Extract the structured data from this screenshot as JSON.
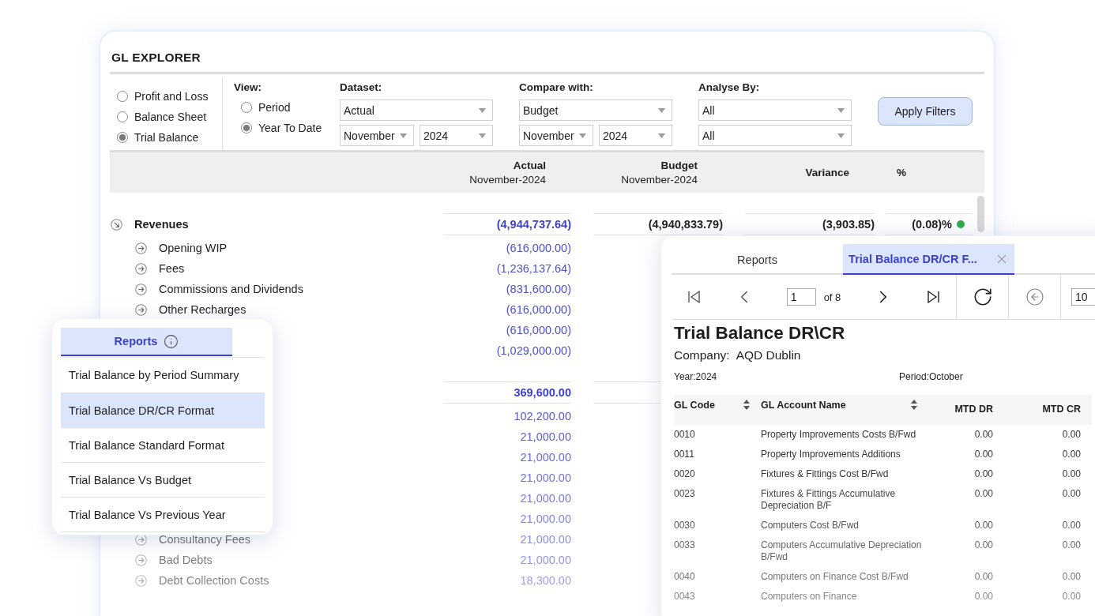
{
  "title": "GL EXPLORER",
  "report_types": [
    {
      "label": "Profit and Loss",
      "selected": false
    },
    {
      "label": "Balance Sheet",
      "selected": false
    },
    {
      "label": "Trial Balance",
      "selected": true
    }
  ],
  "view": {
    "label": "View:",
    "options": [
      {
        "label": "Period",
        "selected": false
      },
      {
        "label": "Year To Date",
        "selected": true
      }
    ]
  },
  "filters": [
    {
      "label": "Dataset:",
      "rows": [
        [
          "Actual"
        ],
        [
          "November",
          "2024"
        ]
      ]
    },
    {
      "label": "Compare with:",
      "rows": [
        [
          "Budget"
        ],
        [
          "November",
          "2024"
        ]
      ]
    },
    {
      "label": "Analyse By:",
      "rows": [
        [
          "All"
        ],
        [
          "All"
        ]
      ]
    }
  ],
  "apply_button": "Apply Filters",
  "columns": [
    {
      "title": "Actual",
      "subtitle": "November-2024"
    },
    {
      "title": "Budget",
      "subtitle": "November-2024"
    },
    {
      "title": "Variance"
    },
    {
      "title": "%"
    }
  ],
  "groups": [
    {
      "label": "Revenues",
      "expanded": true,
      "actual": "(4,944,737.64)",
      "budget": "(4,940,833.79)",
      "variance": "(3,903.85)",
      "percent": "(0.08)%",
      "color": "#2eaa4a",
      "children": [
        {
          "label": "Opening WIP",
          "expanded": false,
          "actual": "(616,000.00)"
        },
        {
          "label": "Fees",
          "expanded": false,
          "actual": "(1,236,137.64)"
        },
        {
          "label": "Commissions and Dividends",
          "expanded": false,
          "actual": "(831,600.00)"
        },
        {
          "label": "Other Recharges",
          "expanded": false,
          "actual": "(616,000.00)"
        },
        {
          "actual": "(616,000.00)"
        },
        {
          "actual": "(1,029,000.00)"
        }
      ]
    },
    {
      "actual": "369,600.00",
      "children": [
        {
          "actual": "102,200.00"
        },
        {
          "actual": "21,000.00"
        },
        {
          "actual": "21,000.00"
        },
        {
          "actual": "21,000.00"
        },
        {
          "actual": "21,000.00"
        },
        {
          "actual": "21,000.00"
        },
        {
          "label": "Consultancy Fees",
          "expanded": false,
          "actual": "21,000.00"
        },
        {
          "label": "Bad Debts",
          "expanded": false,
          "actual": "21,000.00"
        },
        {
          "label": "Debt Collection Costs",
          "expanded": false,
          "actual": "18,300.00"
        }
      ]
    }
  ],
  "reports_popup": {
    "tab": "Reports",
    "items": [
      {
        "label": "Trial Balance by Period Summary",
        "selected": false
      },
      {
        "label": "Trial Balance DR/CR Format",
        "selected": true
      },
      {
        "label": "Trial Balance Standard Format",
        "selected": false
      },
      {
        "label": "Trial Balance Vs Budget",
        "selected": false
      },
      {
        "label": "Trial Balance Vs Previous Year",
        "selected": false
      }
    ]
  },
  "viewer": {
    "tabs": [
      {
        "label": "Reports",
        "selected": false,
        "closable": false
      },
      {
        "label": "Trial Balance DR/CR F...",
        "selected": true,
        "closable": true
      }
    ],
    "page": "1",
    "page_count": "of 8",
    "zoom": "10",
    "report": {
      "title": "Trial Balance DR\\CR",
      "company_label": "Company:",
      "company": "AQD Dublin",
      "year": "Year:2024",
      "period": "Period:October",
      "columns": [
        {
          "label": "GL Code",
          "sortable": true
        },
        {
          "label": "GL Account Name",
          "sortable": true
        },
        {
          "label": "MTD DR",
          "sortable": false
        },
        {
          "label": "MTD CR",
          "sortable": false
        }
      ],
      "rows": [
        [
          "0010",
          "Property Improvements Costs B/Fwd",
          "0.00",
          "0.00"
        ],
        [
          "0011",
          "Property Improvements Additions",
          "0.00",
          "0.00"
        ],
        [
          "0020",
          "Fixtures & Fittings Cost B/Fwd",
          "0.00",
          "0.00"
        ],
        [
          "0023",
          "Fixtures & Fittings Accumulative Depreciation B/F",
          "0.00",
          "0.00"
        ],
        [
          "0030",
          "Computers Cost B/Fwd",
          "0.00",
          "0.00"
        ],
        [
          "0033",
          "Computers Accumulative Depreciation B/Fwd",
          "0.00",
          "0.00"
        ],
        [
          "0040",
          "Computers on Finance Cost B/Fwd",
          "0.00",
          "0.00"
        ],
        [
          "0043",
          "Computers on Finance",
          "0.00",
          "0.00"
        ]
      ]
    }
  }
}
